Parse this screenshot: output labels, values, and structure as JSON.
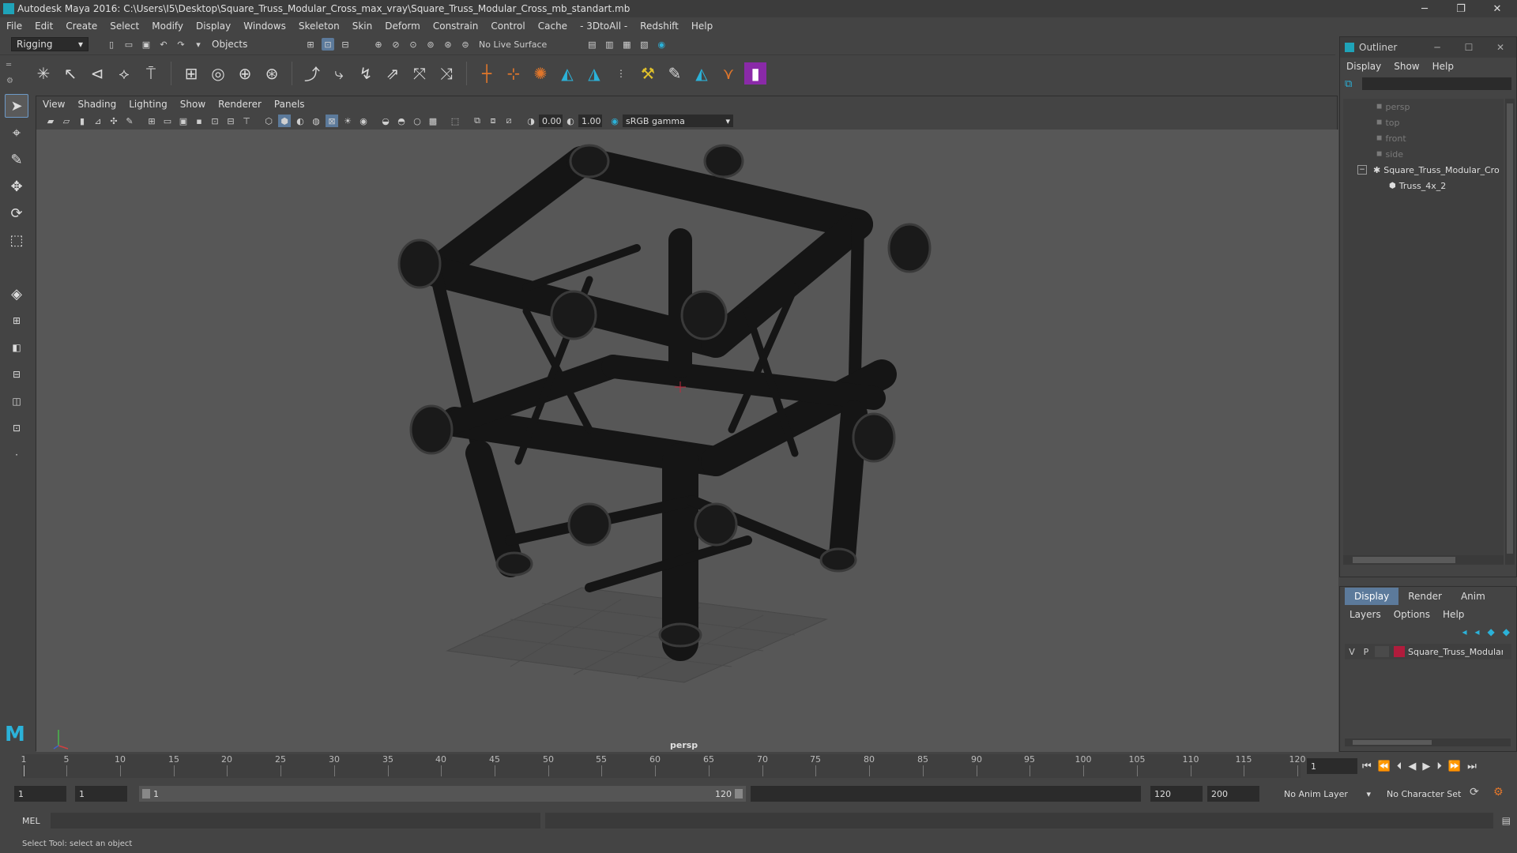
{
  "window": {
    "title": "Autodesk Maya 2016: C:\\Users\\I5\\Desktop\\Square_Truss_Modular_Cross_max_vray\\Square_Truss_Modular_Cross_mb_standart.mb",
    "minimize": "─",
    "restore": "❐",
    "close": "✕"
  },
  "menubar": [
    "File",
    "Edit",
    "Create",
    "Select",
    "Modify",
    "Display",
    "Windows",
    "Skeleton",
    "Skin",
    "Deform",
    "Constrain",
    "Control",
    "Cache",
    "- 3DtoAll -",
    "Redshift",
    "Help"
  ],
  "statusline": {
    "menuset": "Rigging",
    "selection_mask": "Objects",
    "live_surface": "No Live Surface"
  },
  "viewport": {
    "menus": [
      "View",
      "Shading",
      "Lighting",
      "Show",
      "Renderer",
      "Panels"
    ],
    "exposure": "0.00",
    "gamma": "1.00",
    "colorspace": "sRGB gamma",
    "camera_label": "persp"
  },
  "outliner": {
    "title": "Outliner",
    "menus": [
      "Display",
      "Show",
      "Help"
    ],
    "items": [
      {
        "label": "persp",
        "dim": true
      },
      {
        "label": "top",
        "dim": true
      },
      {
        "label": "front",
        "dim": true
      },
      {
        "label": "side",
        "dim": true
      },
      {
        "label": "Square_Truss_Modular_Cro",
        "dim": false
      },
      {
        "label": "Truss_4x_2",
        "dim": false
      }
    ]
  },
  "layer_editor": {
    "tabs": [
      "Display",
      "Render",
      "Anim"
    ],
    "menus": [
      "Layers",
      "Options",
      "Help"
    ],
    "layer": {
      "visible": "V",
      "playback": "P",
      "name": "Square_Truss_Modular",
      "color": "#b01c3c"
    }
  },
  "timeline": {
    "ticks": [
      "5",
      "10",
      "15",
      "20",
      "25",
      "30",
      "35",
      "40",
      "45",
      "50",
      "55",
      "60",
      "65",
      "70",
      "75",
      "80",
      "85",
      "90",
      "95",
      "100",
      "105",
      "110",
      "115",
      "120"
    ],
    "first_tick": "1",
    "current_frame": "1"
  },
  "range": {
    "start": "1",
    "playback_start": "1",
    "range_start_label": "1",
    "range_end_label": "120",
    "playback_end": "120",
    "end": "200",
    "anim_layer": "No Anim Layer",
    "character_set": "No Character Set"
  },
  "commandline": {
    "language": "MEL"
  },
  "helpline": {
    "text": "Select Tool: select an object"
  },
  "colors": {
    "accent": "#5c7a9b",
    "maya_teal": "#1fa3b8"
  }
}
